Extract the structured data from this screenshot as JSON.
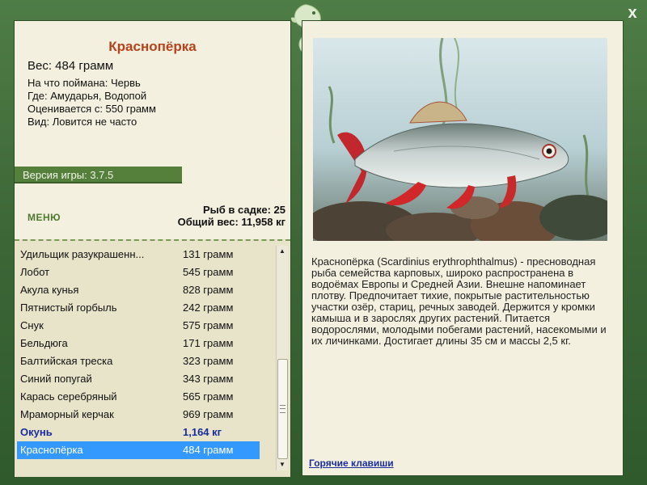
{
  "window": {
    "close_label": "x"
  },
  "fish": {
    "title": "Краснопёрка",
    "weight_line": "Вес: 484 грамм",
    "info": [
      "На что поймана: Червь",
      "Где: Амударья, Водопой",
      "Оценивается с: 550 грамм",
      "Вид: Ловится не часто"
    ]
  },
  "version": "Версия игры: 3.7.5",
  "menu_label": "МЕНЮ",
  "stats": {
    "count": "Рыб в садке: 25",
    "total": "Общий вес: 11,958 кг"
  },
  "catch_list": [
    {
      "name": "Удильщик разукрашенн...",
      "weight": "131 грамм"
    },
    {
      "name": "Лобот",
      "weight": "545 грамм"
    },
    {
      "name": "Акула кунья",
      "weight": "828 грамм"
    },
    {
      "name": "Пятнистый горбыль",
      "weight": "242 грамм"
    },
    {
      "name": "Снук",
      "weight": "575 грамм"
    },
    {
      "name": "Бельдюга",
      "weight": "171 грамм"
    },
    {
      "name": "Балтийская треска",
      "weight": "323 грамм"
    },
    {
      "name": "Синий попугай",
      "weight": "343 грамм"
    },
    {
      "name": "Карась серебряный",
      "weight": "565 грамм"
    },
    {
      "name": "Мраморный керчак",
      "weight": "969 грамм"
    },
    {
      "name": "Окунь",
      "weight": "1,164 кг"
    },
    {
      "name": "Краснопёрка",
      "weight": "484 грамм"
    }
  ],
  "scroll": {
    "up_arrow": "▲",
    "down_arrow": "▼"
  },
  "description": "Краснопёрка (Scardinius erythrophthalmus) - пресноводная рыба семейства карповых, широко распространена в водоёмах Европы и Средней Азии. Внешне напоминает плотву. Предпочитает тихие, покрытые растительностью участки озёр, стариц, речных заводей. Держится у кромки камыша и в зарослях других растений. Питается водорослями, молодыми побегами растений, насекомыми и их личинками. Достигает длины 35 см и массы 2,5 кг.",
  "hotkeys_label": "Горячие клавиши"
}
